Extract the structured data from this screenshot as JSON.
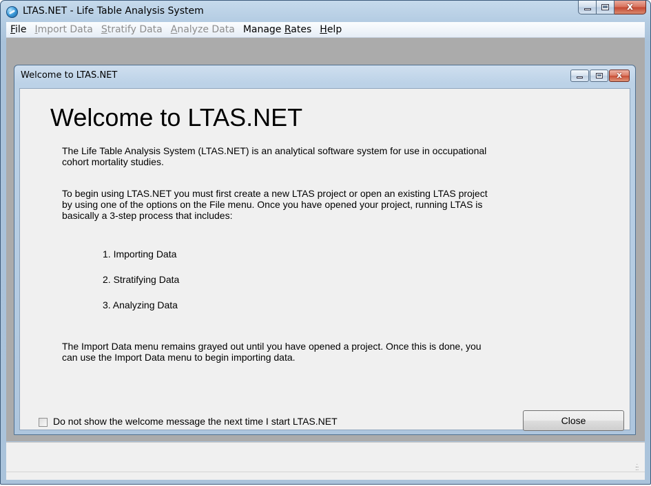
{
  "window": {
    "title": "LTAS.NET - Life Table Analysis System",
    "icon": "ltas-app-icon",
    "controls": {
      "minimize": "minimize",
      "maximize": "maximize",
      "close": "x"
    }
  },
  "menu": [
    {
      "label": "File",
      "mnemonic_index": 0,
      "enabled": true
    },
    {
      "label": "Import Data",
      "mnemonic_index": 0,
      "enabled": false
    },
    {
      "label": "Stratify Data",
      "mnemonic_index": 0,
      "enabled": false
    },
    {
      "label": "Analyze Data",
      "mnemonic_index": 0,
      "enabled": false
    },
    {
      "label": "Manage Rates",
      "mnemonic_index": 7,
      "enabled": true
    },
    {
      "label": "Help",
      "mnemonic_index": 0,
      "enabled": true
    }
  ],
  "child_window": {
    "title": "Welcome to LTAS.NET",
    "heading": "Welcome to LTAS.NET",
    "paragraphs": {
      "intro_line1": "The Life Table Analysis System (LTAS.NET) is an analytical software system for use in occupational",
      "intro_line2": "cohort mortality studies.",
      "begin_line1": "To begin using LTAS.NET you must first create a new LTAS project or open an existing LTAS project",
      "begin_line2": "by using one of the options on the File menu.  Once you have opened your project, running LTAS is",
      "begin_line3": "basically a 3-step process that includes:",
      "import_line1": "The Import Data menu remains grayed out until you have opened a project. Once this is done, you",
      "import_line2": "can use the Import Data menu to begin importing data."
    },
    "steps": [
      "1. Importing Data",
      "2. Stratifying Data",
      "3. Analyzing Data"
    ],
    "checkbox_label": "Do not show the welcome message the next time I start LTAS.NET",
    "checkbox_checked": false,
    "close_button": "Close"
  },
  "colors": {
    "title_gradient_top": "#c6daec",
    "mdi_background": "#ababab",
    "content_background": "#f0f0f0",
    "disabled_menu_text": "#8d8d8d",
    "close_button_red": "#c44631"
  }
}
